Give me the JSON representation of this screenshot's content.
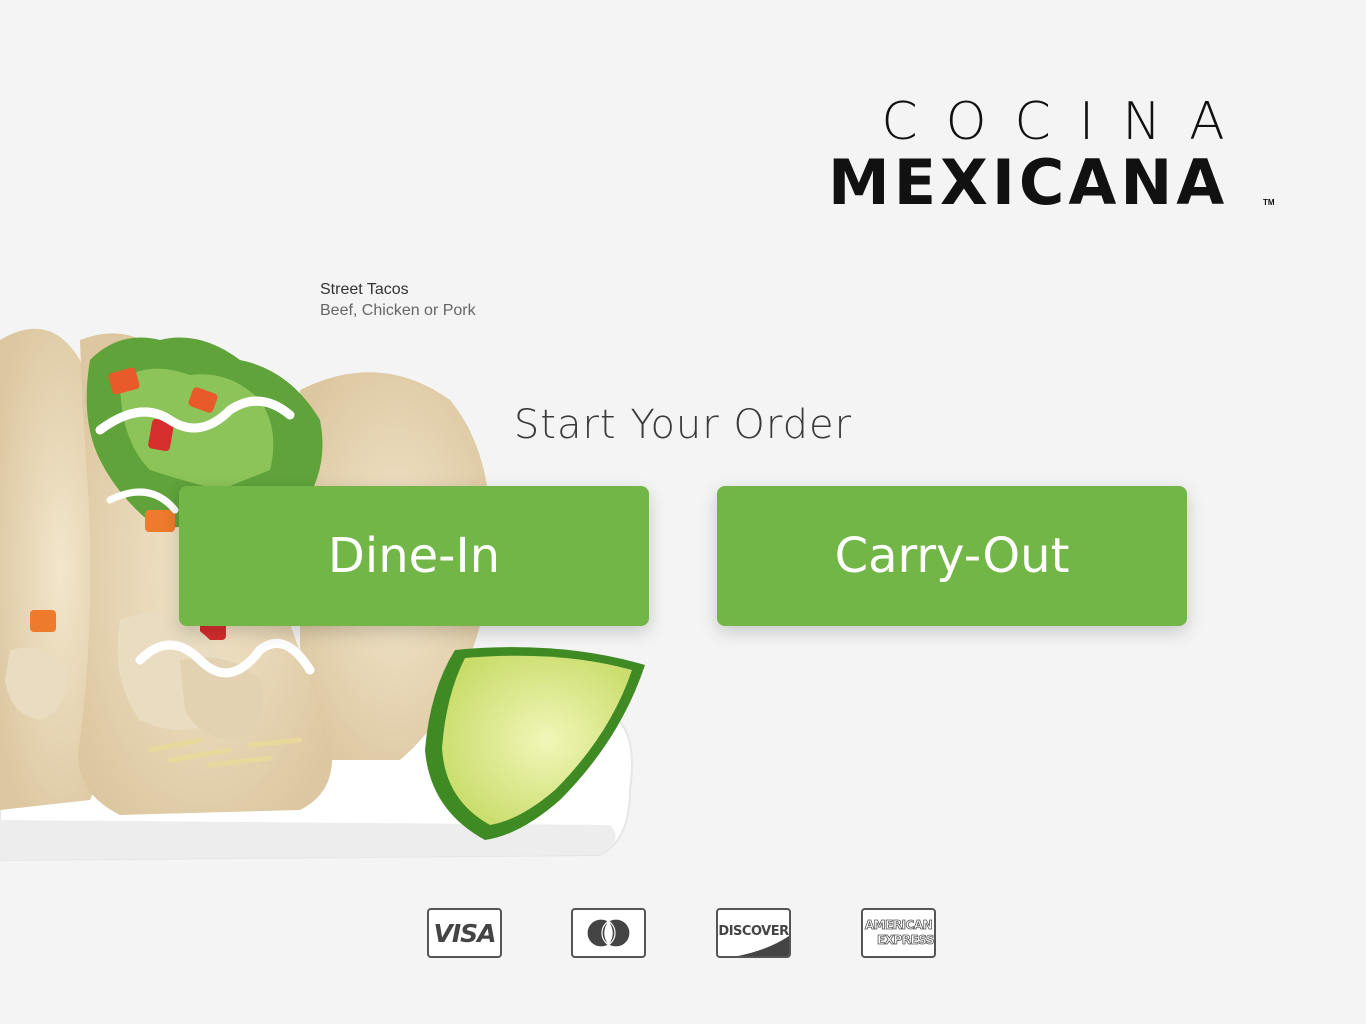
{
  "brand": {
    "line1": "COCINA",
    "line2": "MEXICANA",
    "trademark": "TM"
  },
  "featured_item": {
    "title": "Street Tacos",
    "subtitle": "Beef, Chicken or Pork"
  },
  "order": {
    "headline": "Start Your Order",
    "dine_in_label": "Dine-In",
    "carry_out_label": "Carry-Out"
  },
  "payment_cards": {
    "visa": "VISA",
    "mastercard_icon": "mastercard-icon",
    "discover": "DISCOVER",
    "amex_line1": "AMERICAN",
    "amex_line2": "EXPRESS"
  },
  "colors": {
    "background": "#f4f4f4",
    "button": "#71b646",
    "button_text": "#ffffff",
    "text": "#3a3a3a"
  }
}
